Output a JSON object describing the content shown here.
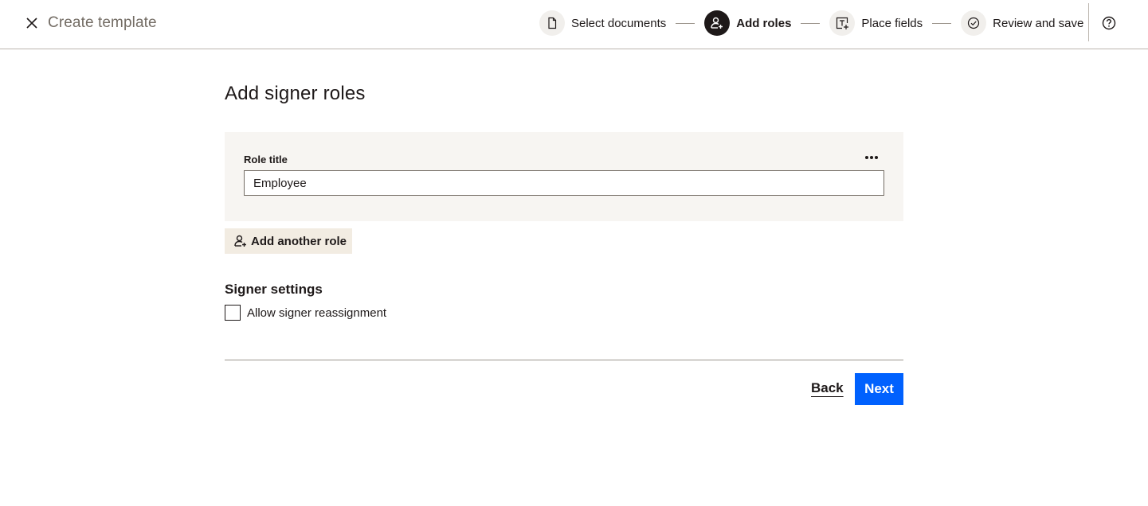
{
  "header": {
    "title": "Create template",
    "close_icon": "close-icon",
    "help_icon": "help-icon",
    "steps": [
      {
        "label": "Select documents",
        "icon": "document-icon",
        "active": false
      },
      {
        "label": "Add roles",
        "icon": "add-person-icon",
        "active": true
      },
      {
        "label": "Place fields",
        "icon": "place-field-icon",
        "active": false
      },
      {
        "label": "Review and save",
        "icon": "check-circle-icon",
        "active": false
      }
    ]
  },
  "main": {
    "title": "Add signer roles",
    "role_card": {
      "label": "Role title",
      "value": "Employee",
      "more_icon": "more-options-icon"
    },
    "add_role_button": {
      "label": "Add another role",
      "icon": "add-person-icon"
    },
    "signer_settings": {
      "title": "Signer settings",
      "checkbox_label": "Allow signer reassignment",
      "checked": false
    }
  },
  "footer": {
    "back_label": "Back",
    "next_label": "Next"
  },
  "colors": {
    "primary": "#0061fe",
    "text": "#1e1919",
    "muted": "#736c64",
    "card_bg": "#f7f5f2",
    "secondary_button_bg": "#f2ece2"
  }
}
